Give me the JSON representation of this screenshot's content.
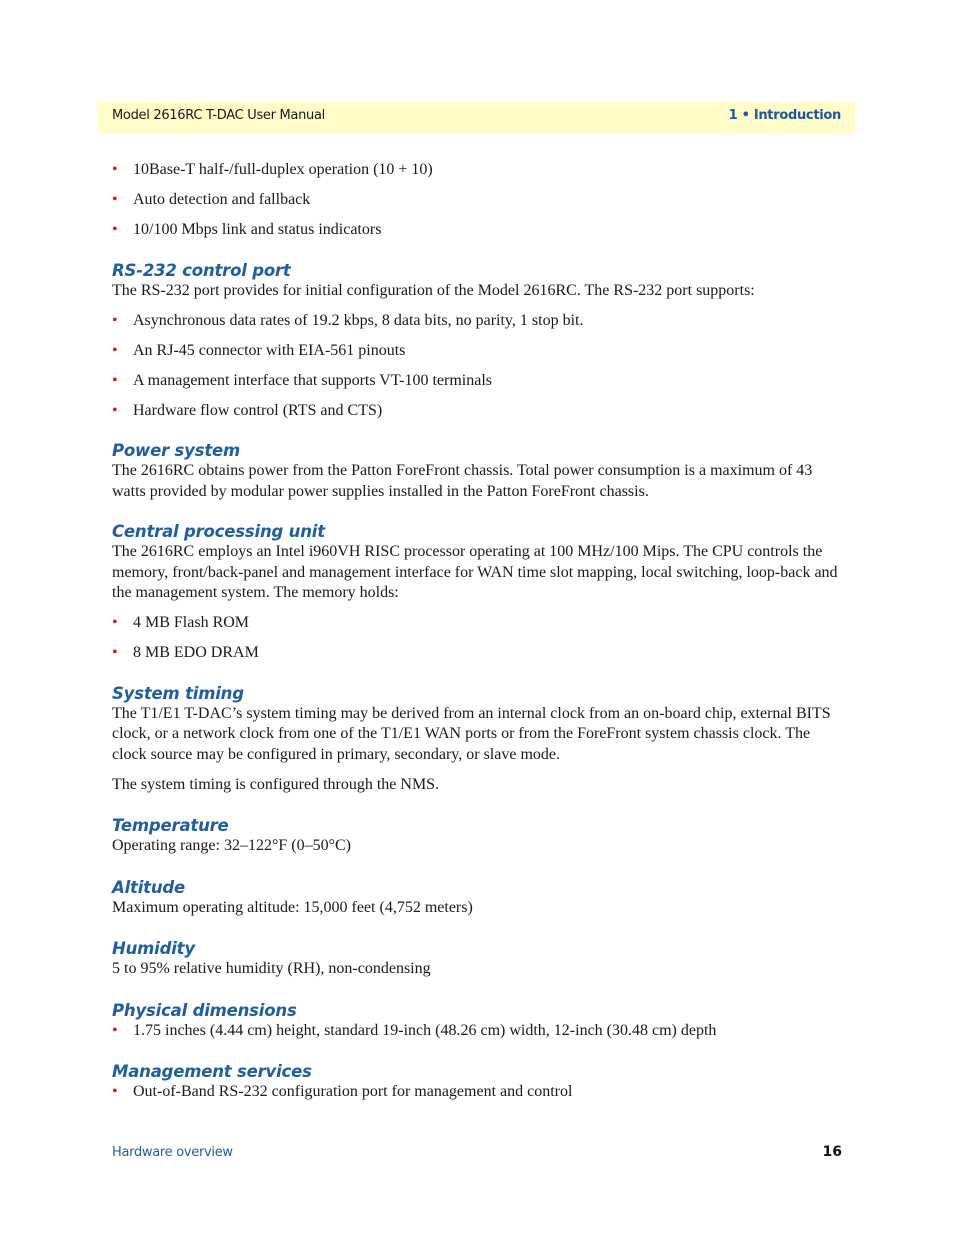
{
  "header": {
    "title": "Model 2616RC T-DAC User Manual",
    "chapter": "1 • Introduction",
    "background_color": "#fffcc8"
  },
  "intro_bullets": [
    "10Base-T half-/full-duplex operation (10 + 10)",
    "Auto detection and fallback",
    "10/100 Mbps link and status indicators"
  ],
  "sections": {
    "rs232": {
      "heading": "RS-232 control port",
      "text": "The RS-232 port provides for initial configuration of the Model 2616RC. The RS-232 port supports:",
      "bullets": [
        "Asynchronous data rates of 19.2 kbps, 8 data bits, no parity, 1 stop bit.",
        "An RJ-45 connector with EIA-561 pinouts",
        "A management interface that supports VT-100 terminals",
        "Hardware flow control (RTS and CTS)"
      ]
    },
    "power": {
      "heading": "Power system",
      "text": "The 2616RC obtains power from the Patton ForeFront chassis. Total power consumption is a maximum of 43 watts provided by modular power supplies installed in the Patton ForeFront chassis."
    },
    "cpu": {
      "heading": "Central processing unit",
      "text": "The 2616RC employs an Intel i960VH RISC processor operating at 100 MHz/100 Mips. The CPU controls the memory, front/back-panel and management interface for WAN time slot mapping, local switching, loop-back and the management system. The memory holds:",
      "bullets": [
        "4 MB Flash ROM",
        "8 MB EDO DRAM"
      ]
    },
    "timing": {
      "heading": "System timing",
      "text": "The T1/E1 T-DAC’s system timing may be derived from an internal clock from an on-board chip, external BITS clock, or a network clock from one of the T1/E1 WAN ports or from the ForeFront system chassis clock. The clock source may be configured in primary, secondary, or slave mode.",
      "text2": "The system timing is configured through the NMS."
    },
    "temperature": {
      "heading": "Temperature",
      "text": "Operating range: 32–122°F (0–50°C)"
    },
    "altitude": {
      "heading": "Altitude",
      "text": "Maximum operating altitude: 15,000 feet (4,752 meters)"
    },
    "humidity": {
      "heading": "Humidity",
      "text": "5 to 95% relative humidity (RH), non-condensing"
    },
    "dimensions": {
      "heading": "Physical dimensions",
      "bullets": [
        "1.75 inches (4.44 cm) height, standard 19-inch (48.26 cm) width, 12-inch (30.48 cm) depth"
      ]
    },
    "management": {
      "heading": "Management services",
      "bullets": [
        "Out-of-Band RS-232 configuration port for management and control"
      ]
    }
  },
  "bullet_glyph": "•",
  "footer": {
    "section": "Hardware overview",
    "page_number": "16"
  }
}
